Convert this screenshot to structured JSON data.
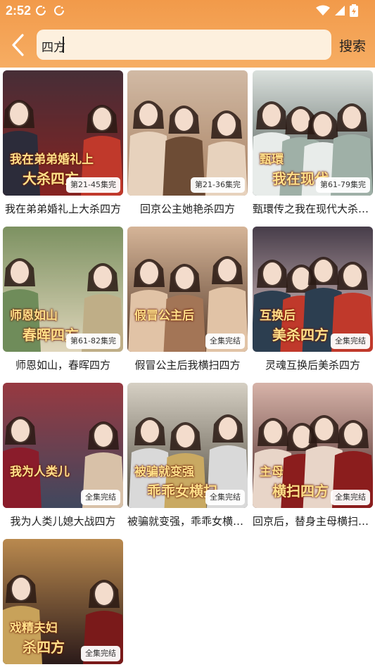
{
  "status": {
    "time": "2:52",
    "left_icons": [
      "sync-icon",
      "sync-icon"
    ],
    "right_icons": [
      "wifi-icon",
      "signal-icon",
      "battery-icon"
    ]
  },
  "search": {
    "query": "四方",
    "button_label": "搜索",
    "back_icon": "chevron-left-icon"
  },
  "colors": {
    "header_top": "#f29a4a",
    "header_bottom": "#f6ad63",
    "search_bg": "#fdf0de",
    "badge_bg": "#ffffff"
  },
  "results": [
    {
      "title": "我在弟弟婚礼上大杀四方",
      "badge": "第21-45集完",
      "poster_text": [
        "我在弟弟婚礼上",
        "大杀四方"
      ],
      "palette": [
        "#7a1f1f",
        "#c0392b",
        "#2c2c3a"
      ]
    },
    {
      "title": "回京公主她艳杀四方",
      "badge": "第21-36集完",
      "poster_text": [],
      "palette": [
        "#b58c6b",
        "#6d4c35",
        "#e7d2bd"
      ]
    },
    {
      "title": "甄環传之我在现代大杀四方",
      "badge": "第61-79集完",
      "poster_text": [
        "甄環",
        "我在现代"
      ],
      "palette": [
        "#2f3a35",
        "#9fb0a7",
        "#e8ecea"
      ]
    },
    {
      "title": "师恩如山，春晖四方",
      "badge": "第61-82集完",
      "poster_text": [
        "师恩如山",
        "春晖四方"
      ],
      "palette": [
        "#e8e0c8",
        "#bfae87",
        "#6f8c5a"
      ]
    },
    {
      "title": "假冒公主后我横扫四方",
      "badge": "全集完结",
      "poster_text": [
        "假冒公主后"
      ],
      "palette": [
        "#4a3224",
        "#a37556",
        "#e1c3a6"
      ]
    },
    {
      "title": "灵魂互换后美杀四方",
      "badge": "全集完结",
      "poster_text": [
        "互换后",
        "美杀四方"
      ],
      "palette": [
        "#f3f3f3",
        "#c0392b",
        "#2c3e50"
      ]
    },
    {
      "title": "我为人类儿媳大战四方",
      "badge": "全集完结",
      "poster_text": [
        "我为人类儿"
      ],
      "palette": [
        "#1f2d4f",
        "#d8c1a8",
        "#8a1c2b"
      ]
    },
    {
      "title": "被骗就变强，乖乖女横扫四方",
      "badge": "全集完结",
      "poster_text": [
        "被骗就变强",
        "乖乖女横扫"
      ],
      "palette": [
        "#3a3a3a",
        "#c9a962",
        "#d9d9d9"
      ]
    },
    {
      "title": "回京后，替身主母横扫四方",
      "badge": "全集完结",
      "poster_text": [
        "主母",
        "横扫四方"
      ],
      "palette": [
        "#3b2a2a",
        "#8b1d1d",
        "#e8d5c8"
      ]
    },
    {
      "title": "",
      "badge": "全集完结",
      "poster_text": [
        "戏精夫妇",
        "杀四方"
      ],
      "palette": [
        "#1a1a1a",
        "#7a1a1a",
        "#c8a25a"
      ]
    }
  ]
}
